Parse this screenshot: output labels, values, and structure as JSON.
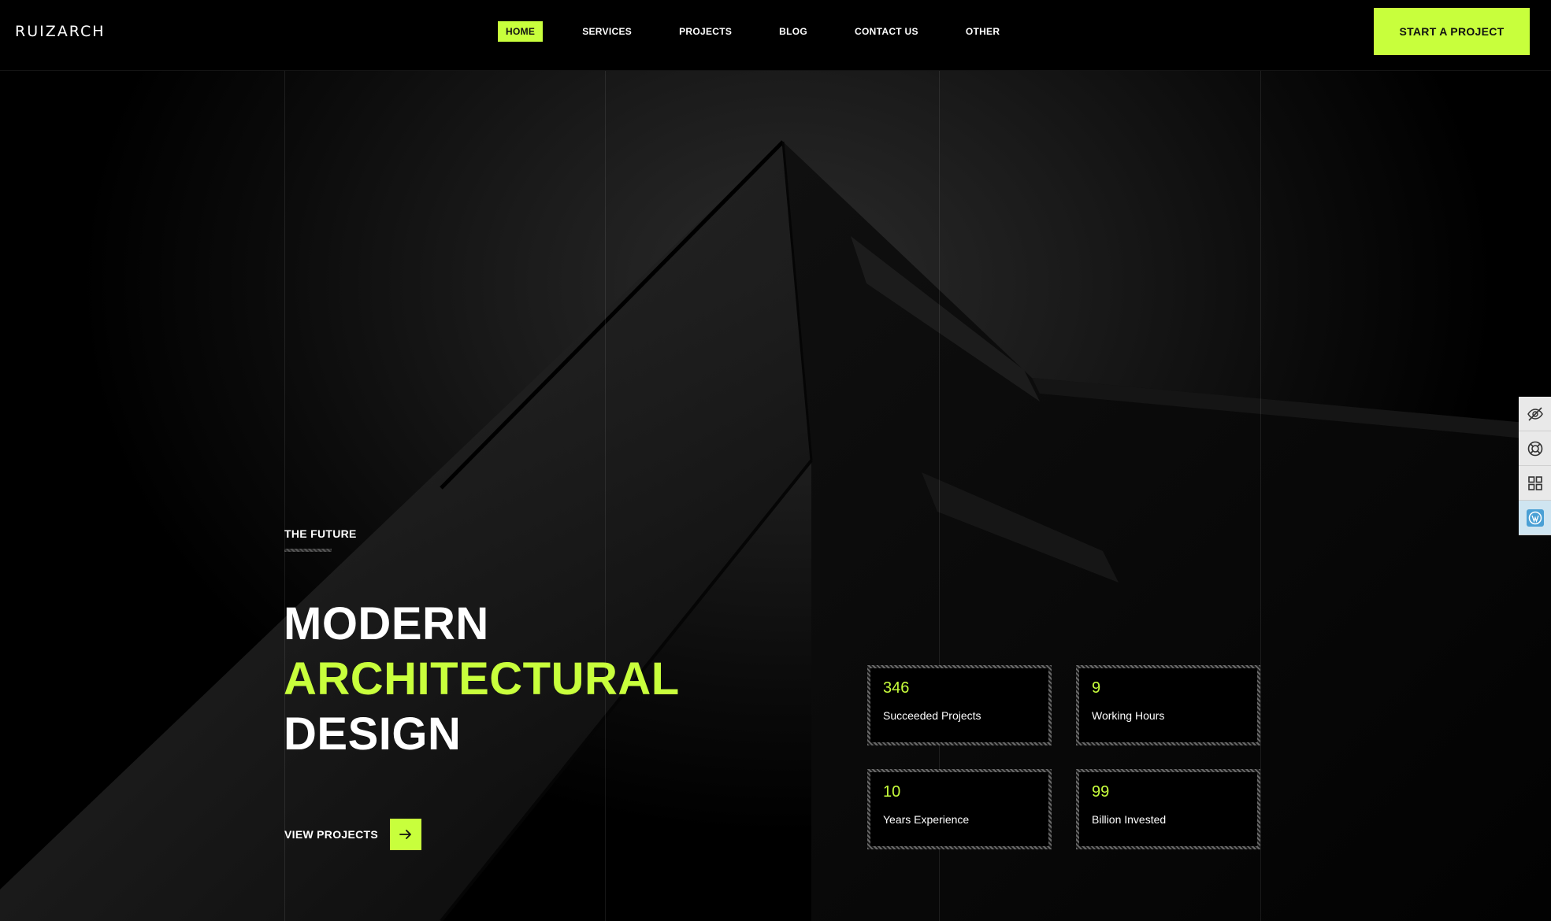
{
  "header": {
    "logo": "RUIZARCH",
    "nav": [
      {
        "label": "HOME",
        "active": true
      },
      {
        "label": "SERVICES"
      },
      {
        "label": "PROJECTS"
      },
      {
        "label": "BLOG"
      },
      {
        "label": "CONTACT US"
      },
      {
        "label": "OTHER"
      }
    ],
    "cta_label": "START A PROJECT"
  },
  "hero": {
    "eyebrow": "THE FUTURE",
    "title_line1": "MODERN",
    "title_line2": "ARCHITECTURAL",
    "title_line3": "DESIGN",
    "view_projects_label": "VIEW PROJECTS"
  },
  "stats": [
    {
      "value": "346",
      "label": "Succeeded Projects"
    },
    {
      "value": "9",
      "label": "Working Hours"
    },
    {
      "value": "10",
      "label": "Years Experience"
    },
    {
      "value": "99",
      "label": "Billion Invested"
    }
  ],
  "side_tools": [
    "eye-off-icon",
    "lifebuoy-icon",
    "grid-icon",
    "wordpress-icon"
  ],
  "colors": {
    "accent": "#c8ff3c",
    "background": "#000000"
  }
}
